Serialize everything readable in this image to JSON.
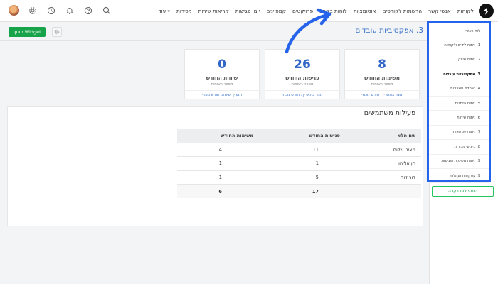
{
  "nav": {
    "items": [
      "לקוחות",
      "אנשי קשר",
      "הרשמות לקורסים",
      "אוטומציות",
      "לוחות בקרה",
      "פרויקטים",
      "קמפיינים",
      "יומן פגישות",
      "קריאות שירות",
      "מכירות",
      "עוד"
    ],
    "icons": [
      "search-icon",
      "help-icon",
      "bell-icon",
      "clock-icon",
      "gear-icon",
      "avatar"
    ]
  },
  "page": {
    "title": "3. אפקטיביות עובדים",
    "add_widget": "הוסף Widget"
  },
  "cards": [
    {
      "value": "8",
      "title": "משימות החודש",
      "subtitle": "מספר רשומות",
      "footer": "נוצר בתאריך: חודש נוכחי"
    },
    {
      "value": "26",
      "title": "פגישות החודש",
      "subtitle": "מספר רשומות",
      "footer": "נוצר בתאריך: חודש נוכחי"
    },
    {
      "value": "0",
      "title": "שיחות החודש",
      "subtitle": "מספר רשומות",
      "footer": "תאריך שיחה: חודש נוכחי"
    }
  ],
  "activity": {
    "title": "פעילות משתמשים",
    "headers": [
      "שם מלא",
      "פגישות החודש",
      "משימות החודש"
    ],
    "rows": [
      [
        "מאיה שלום",
        "11",
        "4"
      ],
      [
        "חן אליהו",
        "1",
        "1"
      ],
      [
        "דור דוד",
        "5",
        "1"
      ]
    ],
    "total": [
      "",
      "17",
      "6"
    ]
  },
  "sidebar": {
    "items": [
      "לוח ראשי",
      "1. ניתוח לידים ולקוחות",
      "2. ניתוח שיווק",
      "3. אפקטיביות עובדים",
      "4. הנהלת חשבונות",
      "5. ניתוח הזמנות",
      "6. ניתוח שיחות",
      "7. ניתוח עסקאות",
      "8. ביצועי מכירות",
      "9. ניתוח משימות ופגישות",
      "9. עסקאות ועמלות"
    ],
    "active_index": 3,
    "add_label": "הוסף לוח בקרה"
  },
  "colors": {
    "accent": "#2563eb",
    "link": "#3b74c9",
    "value": "#3367c7",
    "green": "#16a34a"
  }
}
